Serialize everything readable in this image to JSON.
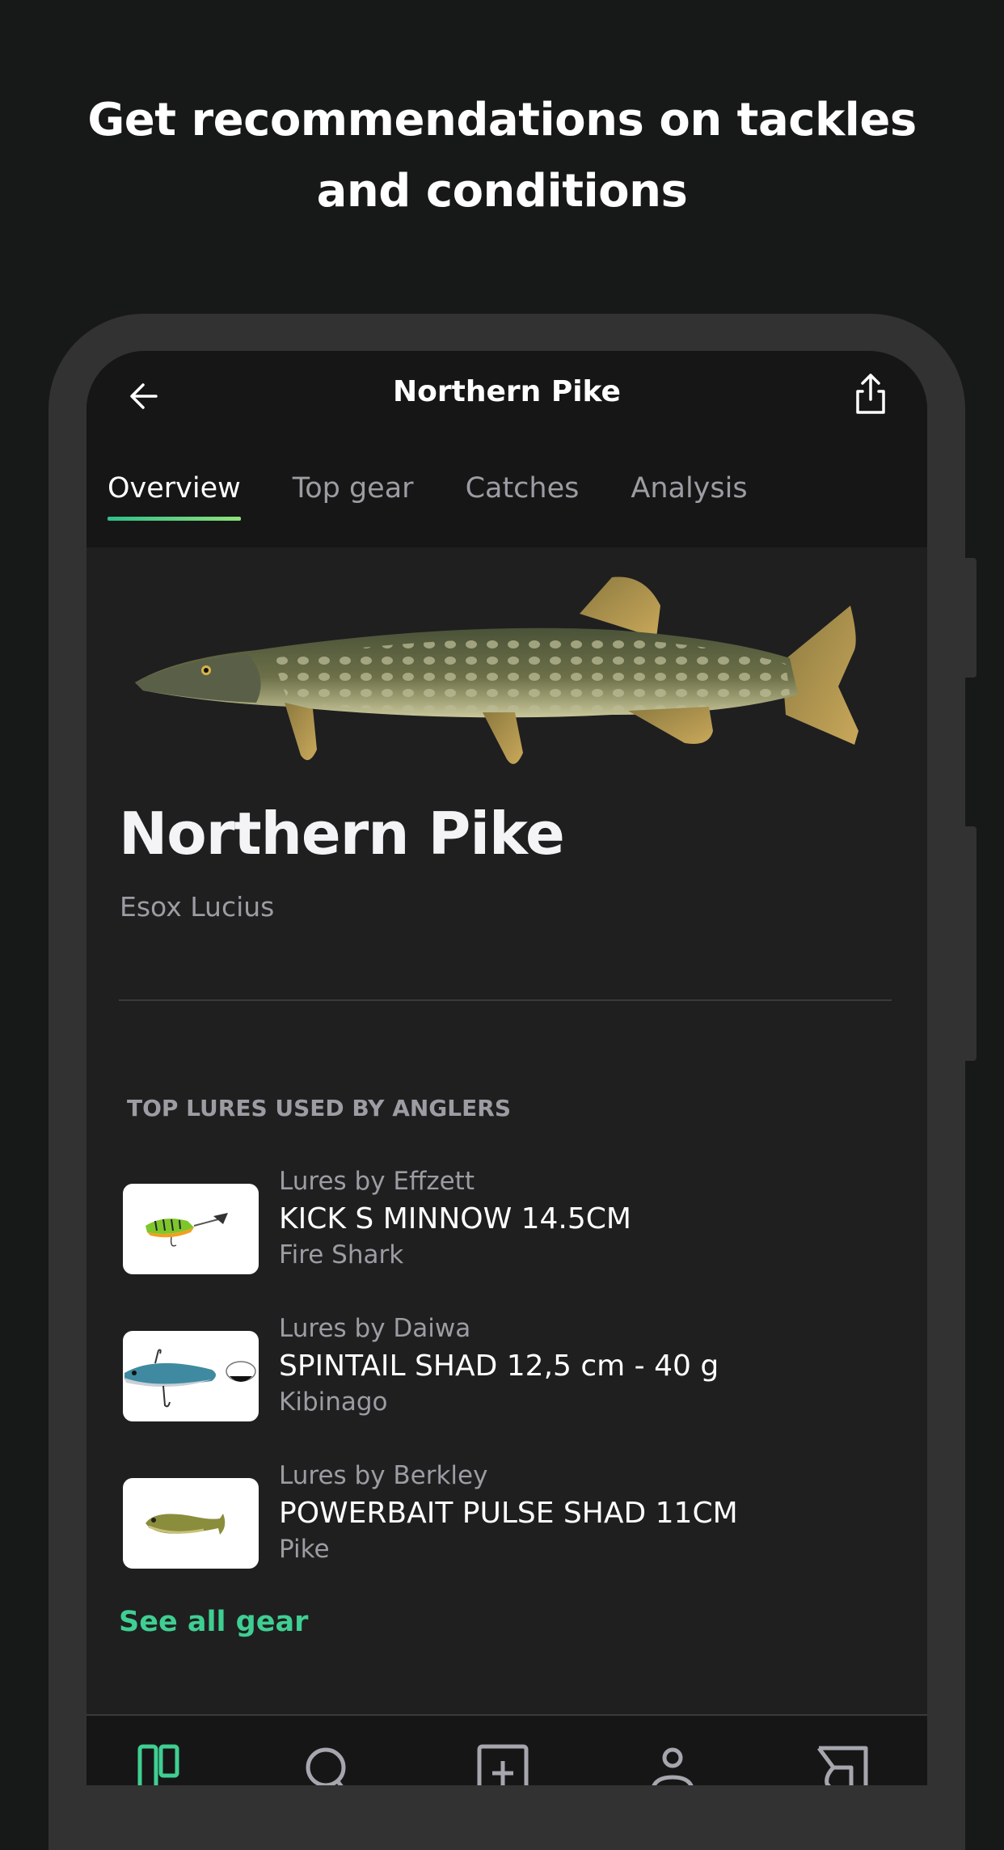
{
  "promo": {
    "line1": "Get recommendations on tackles",
    "line2": "and conditions"
  },
  "appbar": {
    "title": "Northern Pike",
    "back_icon": "arrow-left-icon",
    "share_icon": "share-icon"
  },
  "tabs": [
    {
      "label": "Overview",
      "active": true
    },
    {
      "label": "Top gear",
      "active": false
    },
    {
      "label": "Catches",
      "active": false
    },
    {
      "label": "Analysis",
      "active": false
    }
  ],
  "species": {
    "name": "Northern Pike",
    "latin": "Esox Lucius",
    "image": "northern-pike-illustration"
  },
  "lures_section": {
    "title": "TOP LURES USED BY ANGLERS",
    "items": [
      {
        "brand": "Lures by Effzett",
        "name": "KICK S MINNOW 14.5CM",
        "variant": "Fire Shark",
        "thumb": "fire-tiger-spinner-lure"
      },
      {
        "brand": "Lures by Daiwa",
        "name": "SPINTAIL SHAD 12,5 cm - 40 g",
        "variant": "Kibinago",
        "thumb": "blue-spintail-lure"
      },
      {
        "brand": "Lures by Berkley",
        "name": "POWERBAIT PULSE SHAD 11CM",
        "variant": "Pike",
        "thumb": "olive-soft-shad-lure"
      }
    ],
    "see_all_label": "See all gear"
  },
  "colors": {
    "accent": "#3fcf92",
    "background": "#1f1f20",
    "appbar": "#161617",
    "muted_text": "#9c9ca3"
  },
  "bottom_nav": [
    {
      "icon": "feed-icon",
      "active": true
    },
    {
      "icon": "search-icon",
      "active": false
    },
    {
      "icon": "add-catch-icon",
      "active": false
    },
    {
      "icon": "profile-icon",
      "active": false
    },
    {
      "icon": "map-icon",
      "active": false
    }
  ]
}
